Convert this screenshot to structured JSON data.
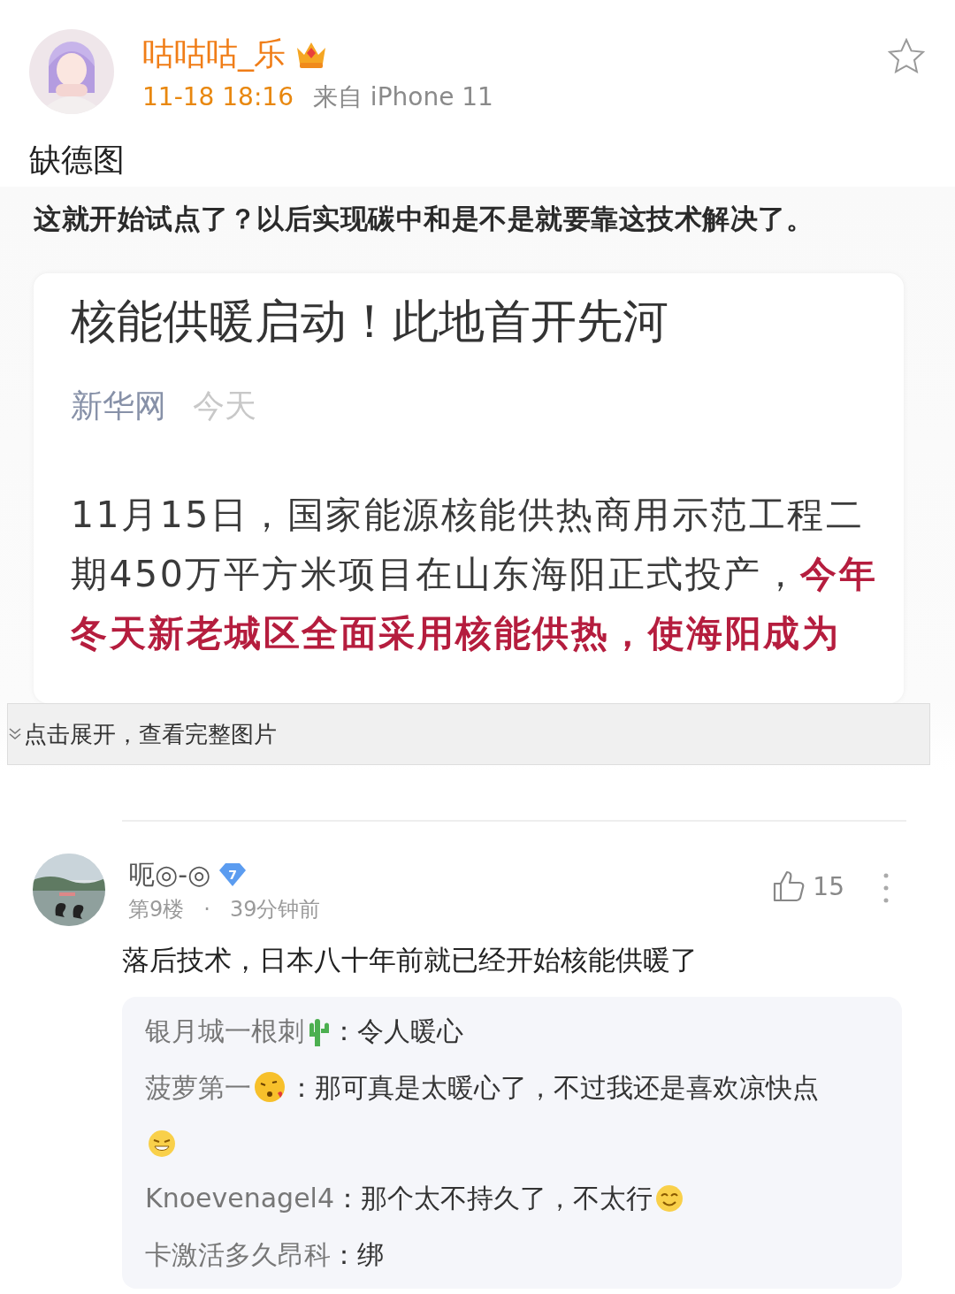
{
  "post": {
    "author": "咕咕咕_乐",
    "vip": true,
    "time": "11-18 18:16",
    "source": "来自 iPhone 11",
    "favorited": false,
    "text": "缺德图"
  },
  "image": {
    "question": "这就开始试点了？以后实现碳中和是不是就要靠这技术解决了。",
    "article": {
      "title": "核能供暖启动！此地首开先河",
      "outlet": "新华网",
      "date": "今天",
      "body": "11月15日，国家能源核能供热商用示范工程二期450万平方米项目在山东海阳正式投产，**今年冬天新老城区全面采用核能供热，使海阳成为**"
    },
    "expand": "点击展开，查看完整图片",
    "comment": {
      "user": "呃◎-◎",
      "level_badge": "7",
      "floor": "第9楼",
      "dot": "·",
      "ago": "39分钟前",
      "likes": "15",
      "liked": false,
      "text": "落后技术，日本八十年前就已经开始核能供暖了",
      "replies": [
        {
          "user": "银月城一根刺",
          "name_emoji": {
            "kind": "cactus"
          },
          "text": "：令人暖心"
        },
        {
          "user": "菠萝第一",
          "name_emoji": {
            "kind": "kiss"
          },
          "text": "：那可真是太暖心了，不过我还是喜欢凉快点",
          "end_emoji": {
            "kind": "grin"
          }
        },
        {
          "user": "Knoevenagel4",
          "text": "：那个太不持久了，不太行",
          "end_emoji": {
            "kind": "smile"
          }
        },
        {
          "user": "卡激活多久昂科",
          "text": "：绑"
        }
      ]
    }
  }
}
